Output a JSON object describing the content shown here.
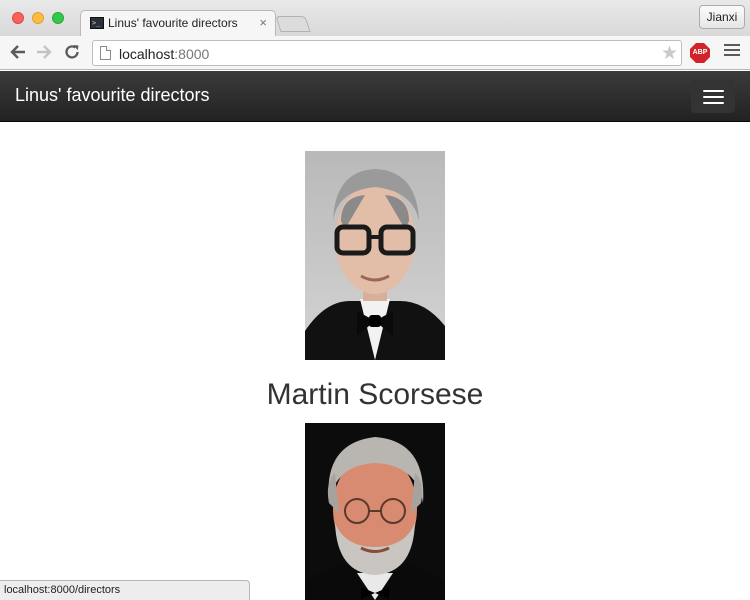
{
  "browser": {
    "tab_title": "Linus' favourite directors",
    "tab_close": "×",
    "profile_name": "Jianxi",
    "url_host": "localhost",
    "url_port": ":8000",
    "adblock_label": "ABP",
    "status_url": "localhost:8000/directors",
    "icons": [
      "back-arrow-icon",
      "forward-arrow-icon",
      "reload-icon",
      "page-icon",
      "star-icon",
      "adblock-icon",
      "menu-icon"
    ]
  },
  "navbar": {
    "brand": "Linus' favourite directors",
    "background": "#222222"
  },
  "directors": [
    {
      "name": "Martin Scorsese"
    },
    {
      "name": ""
    }
  ]
}
